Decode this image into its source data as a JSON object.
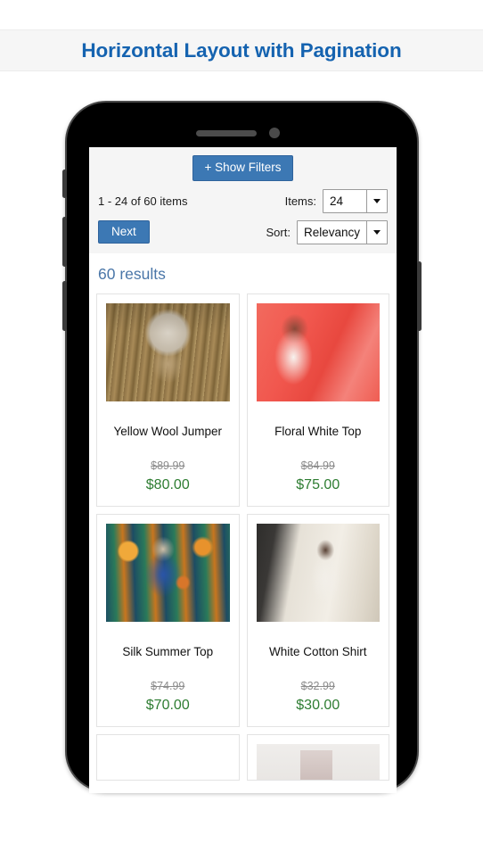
{
  "header": {
    "title": "Horizontal Layout with Pagination"
  },
  "toolbar": {
    "show_filters_label": "+ Show Filters",
    "count_text": "1 - 24 of 60 items",
    "next_label": "Next",
    "items_label": "Items:",
    "items_value": "24",
    "sort_label": "Sort:",
    "sort_value": "Relevancy"
  },
  "results": {
    "heading": "60 results"
  },
  "products": [
    {
      "title": "Yellow Wool Jumper",
      "old_price": "$89.99",
      "new_price": "$80.00",
      "image": "woman-with-camera-in-cornfield"
    },
    {
      "title": "Floral White Top",
      "old_price": "$84.99",
      "new_price": "$75.00",
      "image": "woman-in-white-top-red-background"
    },
    {
      "title": "Silk Summer Top",
      "old_price": "$74.99",
      "new_price": "$70.00",
      "image": "woman-in-blue-dress-at-carnival"
    },
    {
      "title": "White Cotton Shirt",
      "old_price": "$32.99",
      "new_price": "$30.00",
      "image": "woman-in-white-shirt-on-street"
    }
  ],
  "colors": {
    "header_title": "#1563b0",
    "primary_button": "#3c78b4",
    "results_heading": "#4a76a8",
    "sale_price": "#2e7d32",
    "old_price": "#8c8c8c",
    "toolbar_background": "#f5f5f5",
    "card_border": "#e3e3e3"
  }
}
